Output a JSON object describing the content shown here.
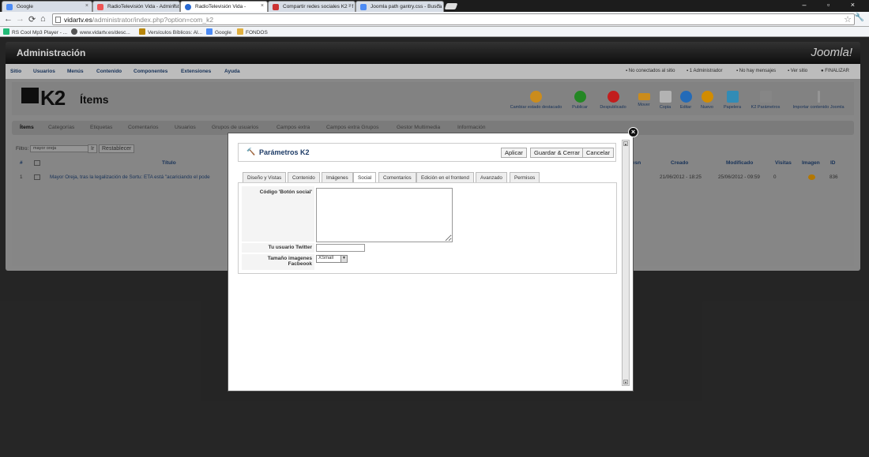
{
  "browser": {
    "tabs": [
      {
        "label": "Google",
        "icon": "google-favicon",
        "color": "#4c8bf5"
      },
      {
        "label": "RadioTelevisión Vida - Administ",
        "icon": "joomla-favicon",
        "color": "#e55"
      },
      {
        "label": "RadioTelevisión Vida -",
        "icon": "site-favicon",
        "color": "#2a6ad2"
      },
      {
        "label": "Compartir redes sociales K2 - f",
        "icon": "forum-favicon",
        "color": "#c33"
      },
      {
        "label": "Joomla path gantry.css - Busca",
        "icon": "google-favicon",
        "color": "#4c8bf5"
      }
    ],
    "close_glyph": "×",
    "window_buttons": "– ▫ ×",
    "nav": {
      "back": "←",
      "forward": "→",
      "reload": "⟳",
      "home": "⌂"
    },
    "url_host": "vidartv.es",
    "url_path": "/administrator/index.php?option=com_k2",
    "bookmarks": [
      {
        "label": "RS Cool Mp3 Player - ...",
        "color": "#2b7"
      },
      {
        "label": "www.vidartv.es/desc...",
        "color": "#555"
      },
      {
        "label": "Versículos Bíblicos: Al...",
        "color": "#b8860b"
      },
      {
        "label": "Google",
        "color": "#4c8bf5"
      },
      {
        "label": "FONDOS",
        "color": "#e0b040"
      }
    ]
  },
  "admin": {
    "header_title": "Administración",
    "brand": "Joomla!",
    "menu": [
      "Sitio",
      "Usuarios",
      "Menús",
      "Contenido",
      "Componentes",
      "Extensiones",
      "Ayuda"
    ],
    "status": [
      "No conectados al sitio",
      "1 Administrador",
      "No hay mensajes",
      "Ver sitio",
      "FINALIZAR"
    ],
    "component_logo": "K2",
    "page_title": "Ítems",
    "toolbar": [
      {
        "label": "Cambiar estado destacado",
        "color": "#e8a020"
      },
      {
        "label": "Publicar",
        "color": "#2a9a2a"
      },
      {
        "label": "Despublicado",
        "color": "#d22"
      },
      {
        "label": "Mover",
        "color": "#e8a020"
      },
      {
        "label": "Copia",
        "color": "#ccc"
      },
      {
        "label": "Editar",
        "color": "#2a7ad2"
      },
      {
        "label": "Nuevo",
        "color": "#f0a000"
      },
      {
        "label": "Papelera",
        "color": "#3aa0d0"
      },
      {
        "label": "K2 Parámetros",
        "color": "#999"
      },
      {
        "label": "Importar contenido Joomla",
        "color": "#aaa"
      }
    ],
    "subnav": [
      "Ítems",
      "Categorías",
      "Etiquetas",
      "Comentarios",
      "Usuarios",
      "Grupos de usuarios",
      "Campos extra",
      "Campos extra Grupos",
      "Gestor Multimedia",
      "Información"
    ],
    "filter_label": "Filtro:",
    "filter_value": "mayor oreja",
    "filter_go": "Ir",
    "filter_reset": "Restablecer",
    "columns": [
      "#",
      "Título",
      "esn",
      "Creado",
      "Modificado",
      "Visitas",
      "Imagen",
      "ID"
    ],
    "row": {
      "num": "1",
      "title": "Mayor Oreja, tras la legalización de Sortu: ETA está \"acariciando el pode",
      "created": "21/06/2012 - 18:25",
      "modified": "25/06/2012 - 09:59",
      "visits": "0",
      "id": "836"
    }
  },
  "modal": {
    "title": "Parámetros K2",
    "buttons": [
      "Aplicar",
      "Guardar & Cerrar",
      "Cancelar"
    ],
    "close_glyph": "×",
    "tabs": [
      "Diseño y Vistas",
      "Contenido",
      "Imágenes",
      "Social",
      "Comentarios",
      "Edición en el frontend",
      "Avanzado",
      "Permisos"
    ],
    "active_tab": "Social",
    "fields": {
      "social_button_label": "Código 'Botón social'",
      "social_button_value": "",
      "twitter_label": "Tu usuario Twitter",
      "twitter_value": "",
      "fb_image_label": "Tamaño imagenes Facbeook",
      "fb_image_value": "XSmall"
    }
  }
}
